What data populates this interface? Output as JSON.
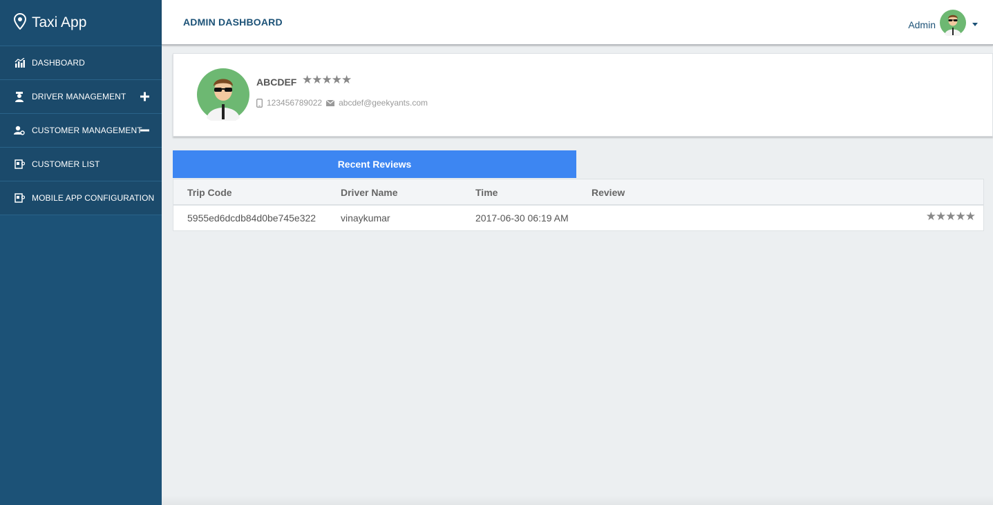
{
  "app": {
    "title": "Taxi App",
    "icon": "map-pin-icon"
  },
  "sidebar": {
    "items": [
      {
        "label": "DASHBOARD",
        "icon": "bar-chart-icon"
      },
      {
        "label": "DRIVER MANAGEMENT",
        "icon": "driver-icon",
        "toggle": "plus-icon"
      },
      {
        "label": "CUSTOMER MANAGEMENT",
        "icon": "user-gear-icon",
        "toggle": "minus-icon"
      },
      {
        "label": "CUSTOMER LIST",
        "icon": "list-card-icon"
      },
      {
        "label": "MOBILE APP CONFIGURATION",
        "icon": "config-card-icon"
      }
    ]
  },
  "header": {
    "title": "ADMIN DASHBOARD",
    "user": {
      "name": "Admin",
      "avatar": "avatar-icon"
    }
  },
  "profile": {
    "name": "ABCDEF",
    "stars": "★★★★★",
    "phone": "123456789022",
    "email": "abcdef@geekyants.com"
  },
  "tabs": {
    "recent_reviews": "Recent Reviews"
  },
  "reviews": {
    "columns": [
      "Trip Code",
      "Driver Name",
      "Time",
      "Review"
    ],
    "rows": [
      {
        "trip_code": "5955ed6dcdb84d0be745e322",
        "driver_name": "vinaykumar",
        "time": "2017-06-30 06:19 AM",
        "review": "★★★★★"
      }
    ]
  },
  "colors": {
    "sidebar": "#1c5277",
    "header_text": "#1c5277",
    "tab_active": "#3d86f2",
    "avatar_bg": "#6db872"
  }
}
